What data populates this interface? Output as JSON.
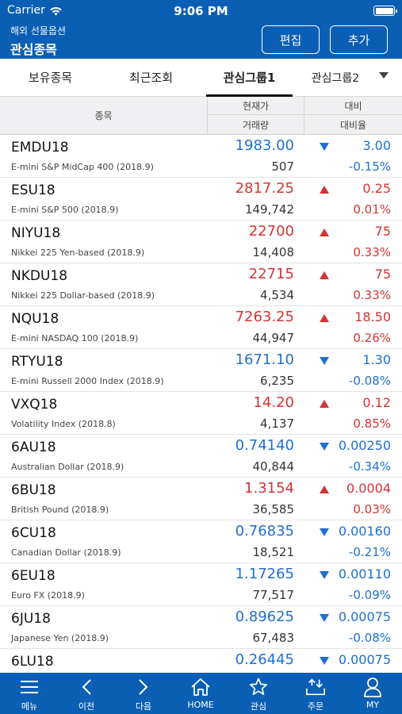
{
  "status_bar": {
    "carrier": "Carrier",
    "time": "9:06 PM"
  },
  "header": {
    "subtitle": "해외 선물옵션",
    "title": "관심종목",
    "edit_label": "편집",
    "add_label": "추가"
  },
  "tabs": [
    {
      "label": "보유종목"
    },
    {
      "label": "최근조회"
    },
    {
      "label": "관심그룹1",
      "selected": true
    },
    {
      "label": "관심그룹2"
    }
  ],
  "table_header": {
    "symbol": "종목",
    "current_price": "현재가",
    "volume": "거래량",
    "change": "대비",
    "change_rate": "대비율"
  },
  "rows": [
    {
      "symbol": "EMDU18",
      "name": "E-mini S&P MidCap 400 (2018.9)",
      "price": "1983.00",
      "volume": "507",
      "direction": "down",
      "change": "3.00",
      "change_rate": "-0.15%"
    },
    {
      "symbol": "ESU18",
      "name": "E-mini S&P 500 (2018.9)",
      "price": "2817.25",
      "volume": "149,742",
      "direction": "up",
      "change": "0.25",
      "change_rate": "0.01%"
    },
    {
      "symbol": "NIYU18",
      "name": "Nikkei 225 Yen-based (2018.9)",
      "price": "22700",
      "volume": "14,408",
      "direction": "up",
      "change": "75",
      "change_rate": "0.33%"
    },
    {
      "symbol": "NKDU18",
      "name": "Nikkei 225 Dollar-based (2018.9)",
      "price": "22715",
      "volume": "4,534",
      "direction": "up",
      "change": "75",
      "change_rate": "0.33%"
    },
    {
      "symbol": "NQU18",
      "name": "E-mini NASDAQ 100 (2018.9)",
      "price": "7263.25",
      "volume": "44,947",
      "direction": "up",
      "change": "18.50",
      "change_rate": "0.26%"
    },
    {
      "symbol": "RTYU18",
      "name": "E-mini Russell 2000 Index (2018.9)",
      "price": "1671.10",
      "volume": "6,235",
      "direction": "down",
      "change": "1.30",
      "change_rate": "-0.08%"
    },
    {
      "symbol": "VXQ18",
      "name": "Volatility Index (2018.8)",
      "price": "14.20",
      "volume": "4,137",
      "direction": "up",
      "change": "0.12",
      "change_rate": "0.85%"
    },
    {
      "symbol": "6AU18",
      "name": "Australian Dollar (2018.9)",
      "price": "0.74140",
      "volume": "40,844",
      "direction": "down",
      "change": "0.00250",
      "change_rate": "-0.34%"
    },
    {
      "symbol": "6BU18",
      "name": "British Pound (2018.9)",
      "price": "1.3154",
      "volume": "36,585",
      "direction": "up",
      "change": "0.0004",
      "change_rate": "0.03%"
    },
    {
      "symbol": "6CU18",
      "name": "Canadian Dollar (2018.9)",
      "price": "0.76835",
      "volume": "18,521",
      "direction": "down",
      "change": "0.00160",
      "change_rate": "-0.21%"
    },
    {
      "symbol": "6EU18",
      "name": "Euro FX (2018.9)",
      "price": "1.17265",
      "volume": "77,517",
      "direction": "down",
      "change": "0.00110",
      "change_rate": "-0.09%"
    },
    {
      "symbol": "6JU18",
      "name": "Japanese Yen (2018.9)",
      "price": "0.89625",
      "volume": "67,483",
      "direction": "down",
      "change": "0.00075",
      "change_rate": "-0.08%"
    },
    {
      "symbol": "6LU18",
      "name": "",
      "price": "0.26445",
      "volume": "",
      "direction": "down",
      "change": "0.00075",
      "change_rate": ""
    }
  ],
  "bottom_nav": [
    {
      "label": "메뉴",
      "icon": "menu-icon"
    },
    {
      "label": "이전",
      "icon": "chevron-left-icon"
    },
    {
      "label": "다음",
      "icon": "chevron-right-icon"
    },
    {
      "label": "HOME",
      "icon": "home-icon"
    },
    {
      "label": "관심",
      "icon": "star-icon"
    },
    {
      "label": "주문",
      "icon": "order-icon"
    },
    {
      "label": "MY",
      "icon": "user-icon"
    }
  ],
  "colors": {
    "brand_blue": "#0a5fb4",
    "up_red": "#d33333",
    "down_blue": "#1f6fcf"
  }
}
